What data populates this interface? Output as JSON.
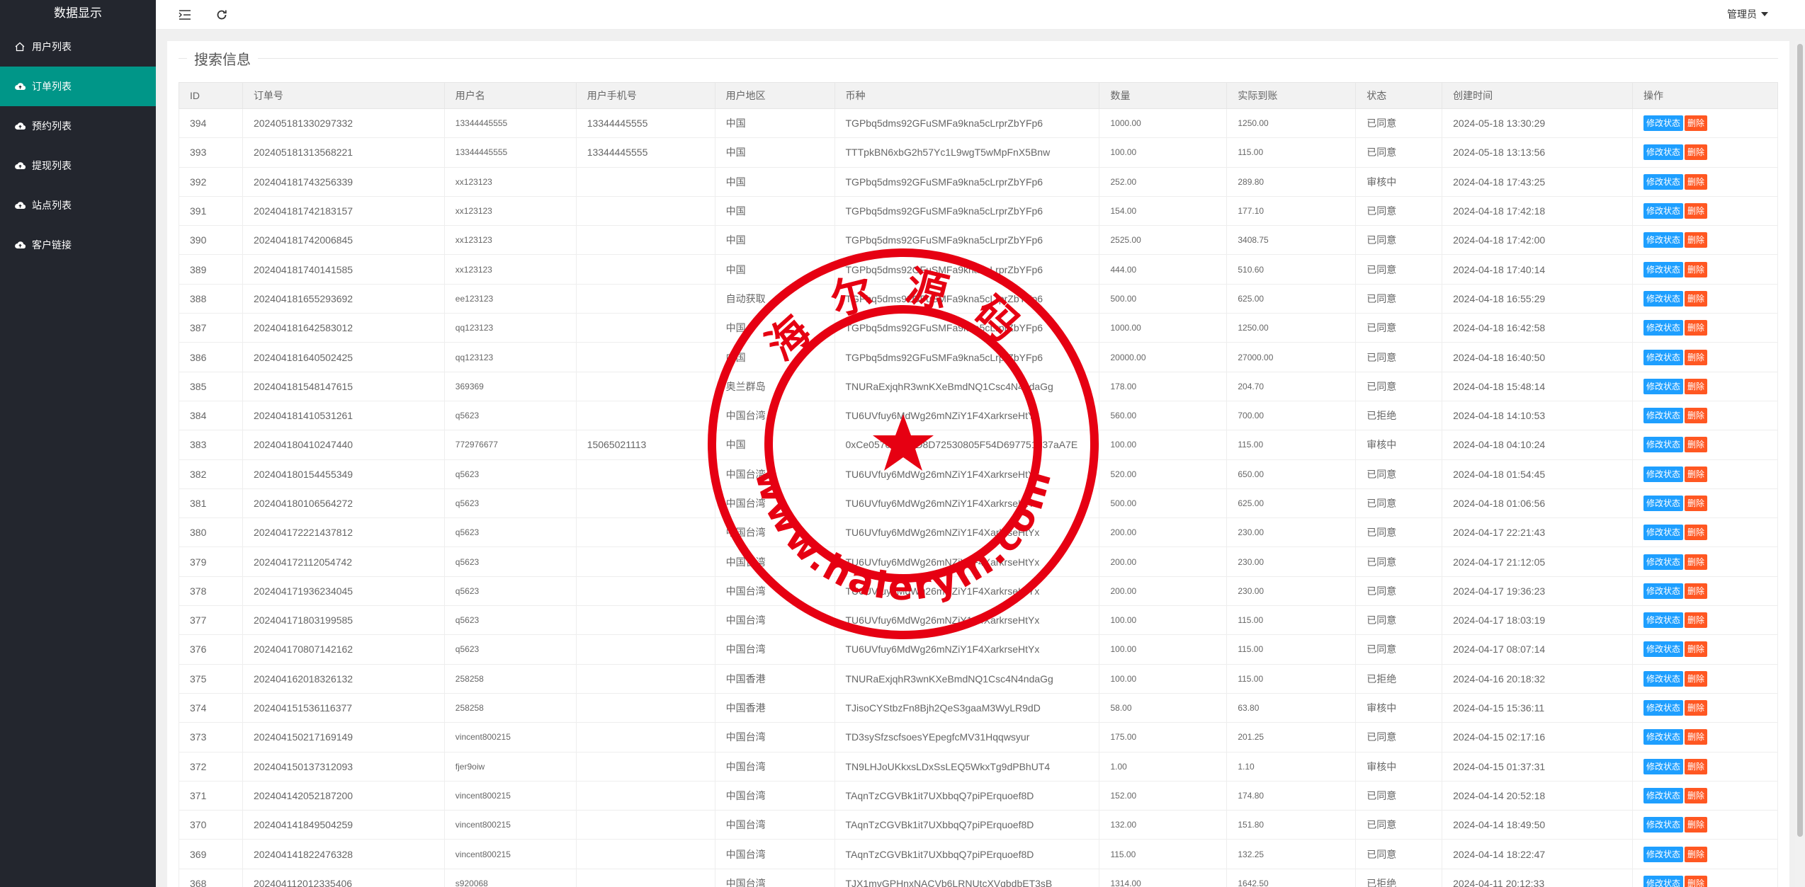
{
  "sidebar": {
    "brand": "数据显示",
    "items": [
      {
        "label": "用户列表",
        "icon": "home-icon",
        "active": false
      },
      {
        "label": "订单列表",
        "icon": "cloud-icon",
        "active": true
      },
      {
        "label": "预约列表",
        "icon": "cloud-icon",
        "active": false
      },
      {
        "label": "提现列表",
        "icon": "cloud-icon",
        "active": false
      },
      {
        "label": "站点列表",
        "icon": "cloud-icon",
        "active": false
      },
      {
        "label": "客户链接",
        "icon": "cloud-icon",
        "active": false
      }
    ]
  },
  "topbar": {
    "admin_label": "管理员"
  },
  "search": {
    "legend": "搜索信息"
  },
  "table": {
    "headers": [
      "ID",
      "订单号",
      "用户名",
      "用户手机号",
      "用户地区",
      "币种",
      "数量",
      "实际到账",
      "状态",
      "创建时间",
      "操作"
    ],
    "edit_label": "修改状态",
    "delete_label": "删除",
    "rows": [
      [
        "394",
        "2024051813302973​32",
        "13344445555",
        "13344445555",
        "中国",
        "TGPbq5dms92GFuSMFa9kna5cLrprZbYFp6",
        "1000.00",
        "1250.00",
        "已同意",
        "2024-05-18 13:30:29"
      ],
      [
        "393",
        "202405181313568221",
        "13344445555",
        "13344445555",
        "中国",
        "TTTpkBN6xbG2h57Yc1L9wgT5wMpFnX5Bnw",
        "100.00",
        "115.00",
        "已同意",
        "2024-05-18 13:13:56"
      ],
      [
        "392",
        "202404181743256339",
        "xx123123",
        "",
        "中国",
        "TGPbq5dms92GFuSMFa9kna5cLrprZbYFp6",
        "252.00",
        "289.80",
        "审核中",
        "2024-04-18 17:43:25"
      ],
      [
        "391",
        "202404181742183157",
        "xx123123",
        "",
        "中国",
        "TGPbq5dms92GFuSMFa9kna5cLrprZbYFp6",
        "154.00",
        "177.10",
        "已同意",
        "2024-04-18 17:42:18"
      ],
      [
        "390",
        "202404181742006845",
        "xx123123",
        "",
        "中国",
        "TGPbq5dms92GFuSMFa9kna5cLrprZbYFp6",
        "2525.00",
        "3408.75",
        "已同意",
        "2024-04-18 17:42:00"
      ],
      [
        "389",
        "202404181740141585",
        "xx123123",
        "",
        "中国",
        "TGPbq5dms92GFuSMFa9kna5cLrprZbYFp6",
        "444.00",
        "510.60",
        "已同意",
        "2024-04-18 17:40:14"
      ],
      [
        "388",
        "202404181655293692",
        "ee123123",
        "",
        "自动获取",
        "TGPbq5dms92GFuSMFa9kna5cLrprZbYFp6",
        "500.00",
        "625.00",
        "已同意",
        "2024-04-18 16:55:29"
      ],
      [
        "387",
        "202404181642583012",
        "qq123123",
        "",
        "中国",
        "TGPbq5dms92GFuSMFa9kna5cLrprZbYFp6",
        "1000.00",
        "1250.00",
        "已同意",
        "2024-04-18 16:42:58"
      ],
      [
        "386",
        "202404181640502425",
        "qq123123",
        "",
        "中国",
        "TGPbq5dms92GFuSMFa9kna5cLrprZbYFp6",
        "20000.00",
        "27000.00",
        "已同意",
        "2024-04-18 16:40:50"
      ],
      [
        "385",
        "202404181548147615",
        "369369",
        "",
        "奥兰群岛",
        "TNURaExjqhR3wnKXeBmdNQ1Csc4N4ndaGg",
        "178.00",
        "204.70",
        "已同意",
        "2024-04-18 15:48:14"
      ],
      [
        "384",
        "202404181410531261",
        "q5623",
        "",
        "中国台湾",
        "TU6UVfuy6MdWg26mNZiY1F4XarkrseHtYx",
        "560.00",
        "700.00",
        "已拒绝",
        "2024-04-18 14:10:53"
      ],
      [
        "383",
        "202404180410247440",
        "772976677",
        "15065021113",
        "中国",
        "0xCe0570f4567D8D72530805F54D697751937aA7E",
        "100.00",
        "115.00",
        "审核中",
        "2024-04-18 04:10:24"
      ],
      [
        "382",
        "202404180154455349",
        "q5623",
        "",
        "中国台湾",
        "TU6UVfuy6MdWg26mNZiY1F4XarkrseHtYx",
        "520.00",
        "650.00",
        "已同意",
        "2024-04-18 01:54:45"
      ],
      [
        "381",
        "202404180106564272",
        "q5623",
        "",
        "中国台湾",
        "TU6UVfuy6MdWg26mNZiY1F4XarkrseHtYx",
        "500.00",
        "625.00",
        "已同意",
        "2024-04-18 01:06:56"
      ],
      [
        "380",
        "202404172221437812",
        "q5623",
        "",
        "中国台湾",
        "TU6UVfuy6MdWg26mNZiY1F4XarkrseHtYx",
        "200.00",
        "230.00",
        "已同意",
        "2024-04-17 22:21:43"
      ],
      [
        "379",
        "202404172112054742",
        "q5623",
        "",
        "中国台湾",
        "TU6UVfuy6MdWg26mNZiY1F4XarkrseHtYx",
        "200.00",
        "230.00",
        "已同意",
        "2024-04-17 21:12:05"
      ],
      [
        "378",
        "202404171936234045",
        "q5623",
        "",
        "中国台湾",
        "TU6UVfuy6MdWg26mNZiY1F4XarkrseHtYx",
        "200.00",
        "230.00",
        "已同意",
        "2024-04-17 19:36:23"
      ],
      [
        "377",
        "202404171803199585",
        "q5623",
        "",
        "中国台湾",
        "TU6UVfuy6MdWg26mNZiY1F4XarkrseHtYx",
        "100.00",
        "115.00",
        "已同意",
        "2024-04-17 18:03:19"
      ],
      [
        "376",
        "202404170807142162",
        "q5623",
        "",
        "中国台湾",
        "TU6UVfuy6MdWg26mNZiY1F4XarkrseHtYx",
        "100.00",
        "115.00",
        "已同意",
        "2024-04-17 08:07:14"
      ],
      [
        "375",
        "202404162018326132",
        "258258",
        "",
        "中国香港",
        "TNURaExjqhR3wnKXeBmdNQ1Csc4N4ndaGg",
        "100.00",
        "115.00",
        "已拒绝",
        "2024-04-16 20:18:32"
      ],
      [
        "374",
        "202404151536116377",
        "258258",
        "",
        "中国香港",
        "TJisoCYStbzFn8Bjh2QeS3gaaM3WyLR9dD",
        "58.00",
        "63.80",
        "审核中",
        "2024-04-15 15:36:11"
      ],
      [
        "373",
        "202404150217169149",
        "vincent800215",
        "",
        "中国台湾",
        "TD3sySfzscfsoesYEpegfcMV31Hqqwsyur",
        "175.00",
        "201.25",
        "已同意",
        "2024-04-15 02:17:16"
      ],
      [
        "372",
        "202404150137312093",
        "fjer9oiw",
        "",
        "中国台湾",
        "TN9LHJoUKkxsLDxSsLEQ5WkxTg9dPBhUT4",
        "1.00",
        "1.10",
        "审核中",
        "2024-04-15 01:37:31"
      ],
      [
        "371",
        "202404142052187200",
        "vincent800215",
        "",
        "中国台湾",
        "TAqnTzCGVBk1it7UXbbqQ7piPErquoef8D",
        "152.00",
        "174.80",
        "已同意",
        "2024-04-14 20:52:18"
      ],
      [
        "370",
        "202404141849504259",
        "vincent800215",
        "",
        "中国台湾",
        "TAqnTzCGVBk1it7UXbbqQ7piPErquoef8D",
        "132.00",
        "151.80",
        "已同意",
        "2024-04-14 18:49:50"
      ],
      [
        "369",
        "202404141822476328",
        "vincent800215",
        "",
        "中国台湾",
        "TAqnTzCGVBk1it7UXbbqQ7piPErquoef8D",
        "115.00",
        "132.25",
        "已同意",
        "2024-04-14 18:22:47"
      ],
      [
        "368",
        "202404112012335406",
        "s920068",
        "",
        "中国台湾",
        "TJX1mvGPHnxNACVb6LRNUtcXVqbdbET3sB",
        "1314.00",
        "1642.50",
        "已拒绝",
        "2024-04-11 20:12:33"
      ]
    ]
  },
  "stamp": {
    "top_text": "海尔源码",
    "bottom_text": "www.haierym.com",
    "color": "#e60012"
  },
  "colors": {
    "sidebar_bg": "#23262e",
    "active_bg": "#009688",
    "edit_btn": "#1e9fff",
    "delete_btn": "#ff5722"
  }
}
